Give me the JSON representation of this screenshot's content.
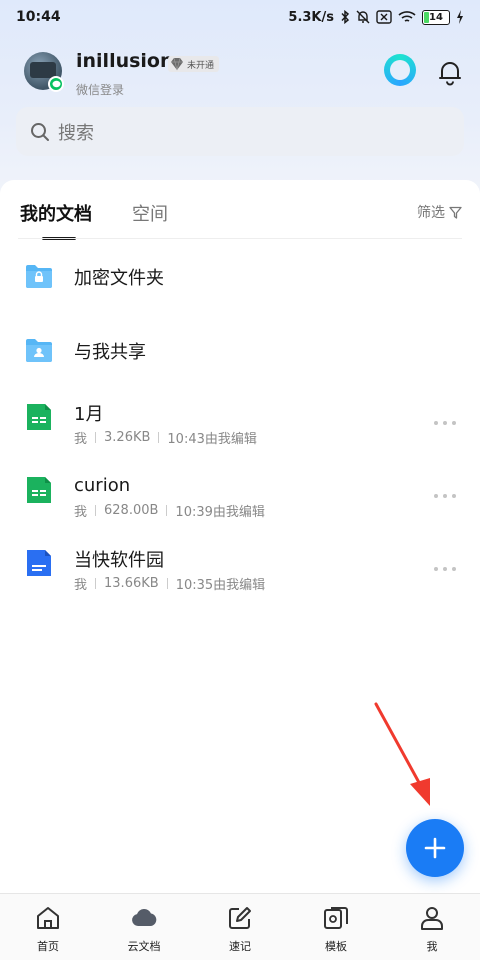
{
  "status_bar": {
    "time": "10:44",
    "speed": "5.3K/s",
    "battery": "14"
  },
  "header": {
    "username": "inillusion",
    "vip_label": "未开通",
    "login_type": "微信登录"
  },
  "search": {
    "placeholder": "搜索"
  },
  "tabs": [
    {
      "label": "我的文档",
      "active": true
    },
    {
      "label": "空间",
      "active": false
    }
  ],
  "filter_label": "筛选",
  "folders": [
    {
      "name": "加密文件夹",
      "icon": "lock-folder-icon"
    },
    {
      "name": "与我共享",
      "icon": "shared-folder-icon"
    }
  ],
  "files": [
    {
      "name": "1月",
      "owner": "我",
      "size": "3.26KB",
      "modified": "10:43由我编辑",
      "type": "spreadsheet",
      "color": "#1bb25e"
    },
    {
      "name": "curion",
      "owner": "我",
      "size": "628.00B",
      "modified": "10:39由我编辑",
      "type": "spreadsheet",
      "color": "#1bb25e"
    },
    {
      "name": "当快软件园",
      "owner": "我",
      "size": "13.66KB",
      "modified": "10:35由我编辑",
      "type": "document",
      "color": "#2a6ff2"
    }
  ],
  "bottom_nav": [
    {
      "label": "首页",
      "icon": "home-icon"
    },
    {
      "label": "云文档",
      "icon": "cloud-icon"
    },
    {
      "label": "速记",
      "icon": "note-icon"
    },
    {
      "label": "模板",
      "icon": "template-icon"
    },
    {
      "label": "我",
      "icon": "user-icon"
    }
  ],
  "colors": {
    "accent": "#1a7cf5",
    "annotation_arrow": "#f03a2e"
  }
}
